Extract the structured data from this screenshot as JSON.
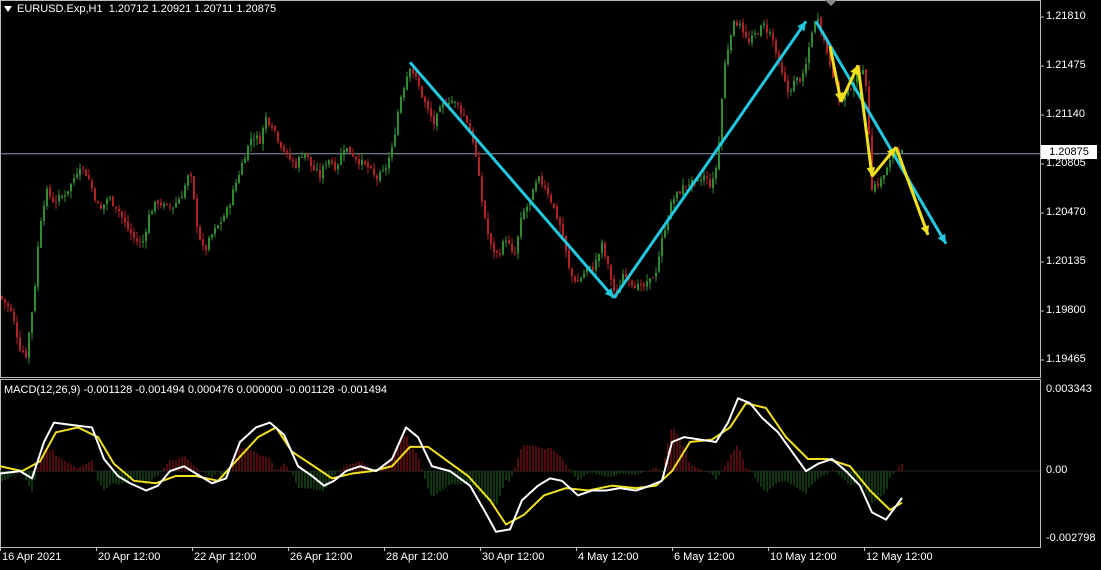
{
  "header": {
    "symbol": "EURUSD.Exp,H1",
    "open": "1.20712",
    "high": "1.20921",
    "low": "1.20711",
    "close": "1.20875"
  },
  "macd_header": "MACD(12,26,9) -0.001128 -0.001494 0.000476 0.000000 -0.001128 -0.001494",
  "current_price_label": "1.20875",
  "colors": {
    "background": "#000000",
    "bull_candle": "#2e8b2e",
    "bear_candle": "#b22222",
    "trend_line": "#22c8e0",
    "wave_line": "#f0e020",
    "macd_line": "#ffffff",
    "signal_line": "#f0e020",
    "hist_positive": "#a01818",
    "hist_negative": "#1e6a1e",
    "price_line": "#8a9ab0"
  },
  "chart_data": [
    {
      "type": "candlestick",
      "title": "EURUSD.Exp,H1",
      "y_ticks": [
        1.2181,
        1.21475,
        1.2114,
        1.20805,
        1.2047,
        1.20135,
        1.198,
        1.19465
      ],
      "y_range": [
        1.1928,
        1.2196
      ],
      "x_ticks": [
        "16 Apr 2021",
        "20 Apr 12:00",
        "22 Apr 12:00",
        "26 Apr 12:00",
        "28 Apr 12:00",
        "30 Apr 12:00",
        "4 May 12:00",
        "6 May 12:00",
        "10 May 12:00",
        "12 May 12:00"
      ],
      "current_price": 1.20875,
      "close_path": [
        [
          0,
          1.199
        ],
        [
          6,
          1.1985
        ],
        [
          12,
          1.1978
        ],
        [
          20,
          1.1955
        ],
        [
          26,
          1.195
        ],
        [
          34,
          1.199
        ],
        [
          40,
          1.204
        ],
        [
          46,
          1.2062
        ],
        [
          54,
          1.2055
        ],
        [
          62,
          1.2058
        ],
        [
          70,
          1.2065
        ],
        [
          80,
          1.208
        ],
        [
          88,
          1.2072
        ],
        [
          94,
          1.206
        ],
        [
          100,
          1.2048
        ],
        [
          108,
          1.2058
        ],
        [
          118,
          1.205
        ],
        [
          126,
          1.2038
        ],
        [
          134,
          1.203
        ],
        [
          142,
          1.2025
        ],
        [
          150,
          1.2048
        ],
        [
          158,
          1.2055
        ],
        [
          166,
          1.205
        ],
        [
          174,
          1.2052
        ],
        [
          182,
          1.206
        ],
        [
          190,
          1.2075
        ],
        [
          198,
          1.2035
        ],
        [
          204,
          1.202
        ],
        [
          212,
          1.2032
        ],
        [
          220,
          1.204
        ],
        [
          228,
          1.205
        ],
        [
          236,
          1.2068
        ],
        [
          244,
          1.2085
        ],
        [
          252,
          1.21
        ],
        [
          260,
          1.2097
        ],
        [
          266,
          1.2112
        ],
        [
          272,
          1.2108
        ],
        [
          280,
          1.2095
        ],
        [
          288,
          1.2085
        ],
        [
          296,
          1.208
        ],
        [
          304,
          1.209
        ],
        [
          312,
          1.2078
        ],
        [
          320,
          1.2072
        ],
        [
          328,
          1.2085
        ],
        [
          336,
          1.2078
        ],
        [
          344,
          1.2092
        ],
        [
          352,
          1.2088
        ],
        [
          360,
          1.2082
        ],
        [
          368,
          1.2078
        ],
        [
          376,
          1.207
        ],
        [
          384,
          1.2075
        ],
        [
          392,
          1.209
        ],
        [
          400,
          1.2125
        ],
        [
          410,
          1.2148
        ],
        [
          418,
          1.2135
        ],
        [
          426,
          1.212
        ],
        [
          434,
          1.2108
        ],
        [
          442,
          1.212
        ],
        [
          450,
          1.2125
        ],
        [
          458,
          1.212
        ],
        [
          466,
          1.2112
        ],
        [
          474,
          1.2095
        ],
        [
          482,
          1.2055
        ],
        [
          490,
          1.2025
        ],
        [
          498,
          1.2018
        ],
        [
          506,
          1.203
        ],
        [
          514,
          1.2015
        ],
        [
          522,
          1.2045
        ],
        [
          530,
          1.2055
        ],
        [
          538,
          1.207
        ],
        [
          546,
          1.2065
        ],
        [
          554,
          1.205
        ],
        [
          562,
          1.2035
        ],
        [
          570,
          1.2005
        ],
        [
          578,
          1.2
        ],
        [
          586,
          1.2008
        ],
        [
          594,
          1.201
        ],
        [
          602,
          1.2025
        ],
        [
          610,
          1.2005
        ],
        [
          616,
          1.1988
        ],
        [
          624,
          1.2008
        ],
        [
          632,
          1.2
        ],
        [
          640,
          1.1995
        ],
        [
          648,
          1.1998
        ],
        [
          656,
          1.2008
        ],
        [
          664,
          1.2035
        ],
        [
          672,
          1.2055
        ],
        [
          680,
          1.2062
        ],
        [
          688,
          1.2068
        ],
        [
          696,
          1.2066
        ],
        [
          704,
          1.2072
        ],
        [
          712,
          1.2065
        ],
        [
          718,
          1.2085
        ],
        [
          724,
          1.2145
        ],
        [
          732,
          1.2175
        ],
        [
          740,
          1.2178
        ],
        [
          748,
          1.2162
        ],
        [
          756,
          1.217
        ],
        [
          764,
          1.2175
        ],
        [
          772,
          1.2168
        ],
        [
          780,
          1.2145
        ],
        [
          788,
          1.213
        ],
        [
          796,
          1.2138
        ],
        [
          804,
          1.214
        ],
        [
          812,
          1.2172
        ],
        [
          818,
          1.2182
        ],
        [
          824,
          1.2165
        ],
        [
          832,
          1.2145
        ],
        [
          840,
          1.2122
        ],
        [
          848,
          1.213
        ],
        [
          856,
          1.214
        ],
        [
          864,
          1.2148
        ],
        [
          868,
          1.2115
        ],
        [
          872,
          1.2065
        ],
        [
          880,
          1.2068
        ],
        [
          888,
          1.2078
        ],
        [
          896,
          1.2092
        ],
        [
          903,
          1.20875
        ]
      ],
      "annotations": {
        "trend_lines": [
          [
            [
              410,
              1.215
            ],
            [
              614,
              1.1989
            ]
          ],
          [
            [
              614,
              1.1989
            ],
            [
              806,
              1.2178
            ]
          ],
          [
            [
              816,
              1.2178
            ],
            [
              946,
              1.2026
            ]
          ]
        ],
        "wave_lines": [
          [
            [
              830,
              1.2161
            ],
            [
              841,
              1.2123
            ],
            [
              858,
              1.2148
            ],
            [
              872,
              1.2072
            ],
            [
              896,
              1.2092
            ],
            [
              928,
              1.2032
            ]
          ]
        ]
      }
    },
    {
      "type": "macd",
      "title": "MACD(12,26,9)",
      "y_ticks": [
        0.003343,
        0.0,
        -0.002798
      ],
      "y_range": [
        -0.002798,
        0.003343
      ],
      "macd_path": [
        [
          0,
          -0.0001
        ],
        [
          20,
          0.0
        ],
        [
          32,
          -0.0003
        ],
        [
          44,
          0.0012
        ],
        [
          54,
          0.002
        ],
        [
          72,
          0.0019
        ],
        [
          92,
          0.0018
        ],
        [
          104,
          0.0005
        ],
        [
          118,
          -0.0002
        ],
        [
          130,
          -0.0005
        ],
        [
          146,
          -0.0008
        ],
        [
          158,
          -0.0006
        ],
        [
          170,
          0.0
        ],
        [
          184,
          0.0002
        ],
        [
          200,
          -0.0002
        ],
        [
          212,
          -0.0005
        ],
        [
          226,
          -0.0003
        ],
        [
          240,
          0.0012
        ],
        [
          256,
          0.0018
        ],
        [
          270,
          0.002
        ],
        [
          284,
          0.0015
        ],
        [
          298,
          0.0002
        ],
        [
          312,
          -0.0002
        ],
        [
          324,
          -0.0006
        ],
        [
          334,
          -0.0004
        ],
        [
          346,
          0.0
        ],
        [
          360,
          0.0002
        ],
        [
          376,
          0.0
        ],
        [
          392,
          0.0005
        ],
        [
          406,
          0.0018
        ],
        [
          418,
          0.0014
        ],
        [
          432,
          0.0002
        ],
        [
          450,
          0.0
        ],
        [
          470,
          -0.0006
        ],
        [
          484,
          -0.0016
        ],
        [
          496,
          -0.0025
        ],
        [
          510,
          -0.0024
        ],
        [
          522,
          -0.0012
        ],
        [
          538,
          -0.0006
        ],
        [
          550,
          -0.0003
        ],
        [
          562,
          -0.0004
        ],
        [
          578,
          -0.001
        ],
        [
          592,
          -0.0008
        ],
        [
          606,
          -0.0008
        ],
        [
          620,
          -0.0007
        ],
        [
          636,
          -0.0008
        ],
        [
          650,
          -0.0006
        ],
        [
          662,
          -0.0004
        ],
        [
          672,
          0.0012
        ],
        [
          684,
          0.0014
        ],
        [
          700,
          0.0013
        ],
        [
          716,
          0.0012
        ],
        [
          728,
          0.002
        ],
        [
          738,
          0.003
        ],
        [
          750,
          0.0028
        ],
        [
          762,
          0.0022
        ],
        [
          778,
          0.0016
        ],
        [
          792,
          0.0008
        ],
        [
          806,
          0.0
        ],
        [
          818,
          0.0003
        ],
        [
          832,
          0.0005
        ],
        [
          846,
          0.0
        ],
        [
          860,
          -0.0006
        ],
        [
          872,
          -0.0017
        ],
        [
          886,
          -0.002
        ],
        [
          902,
          -0.0011
        ]
      ],
      "signal_path": [
        [
          0,
          0.0002
        ],
        [
          22,
          0.0
        ],
        [
          40,
          0.0004
        ],
        [
          56,
          0.0016
        ],
        [
          78,
          0.0018
        ],
        [
          98,
          0.0014
        ],
        [
          114,
          0.0003
        ],
        [
          134,
          -0.0004
        ],
        [
          156,
          -0.0005
        ],
        [
          176,
          -0.0002
        ],
        [
          196,
          -0.0002
        ],
        [
          218,
          -0.0004
        ],
        [
          238,
          0.0005
        ],
        [
          258,
          0.0014
        ],
        [
          276,
          0.0018
        ],
        [
          292,
          0.0008
        ],
        [
          314,
          0.0002
        ],
        [
          332,
          -0.0003
        ],
        [
          352,
          -0.0001
        ],
        [
          372,
          0.0
        ],
        [
          392,
          0.0002
        ],
        [
          410,
          0.001
        ],
        [
          428,
          0.001
        ],
        [
          448,
          0.0004
        ],
        [
          468,
          -0.0002
        ],
        [
          490,
          -0.0012
        ],
        [
          506,
          -0.0022
        ],
        [
          524,
          -0.0018
        ],
        [
          544,
          -0.001
        ],
        [
          566,
          -0.0007
        ],
        [
          588,
          -0.0008
        ],
        [
          612,
          -0.0006
        ],
        [
          636,
          -0.0007
        ],
        [
          656,
          -0.0006
        ],
        [
          672,
          0.0
        ],
        [
          690,
          0.0012
        ],
        [
          712,
          0.0013
        ],
        [
          730,
          0.0018
        ],
        [
          746,
          0.0028
        ],
        [
          766,
          0.0026
        ],
        [
          786,
          0.0014
        ],
        [
          808,
          0.0005
        ],
        [
          828,
          0.0005
        ],
        [
          850,
          0.0002
        ],
        [
          870,
          -0.0008
        ],
        [
          890,
          -0.0016
        ],
        [
          902,
          -0.0013
        ]
      ]
    }
  ]
}
